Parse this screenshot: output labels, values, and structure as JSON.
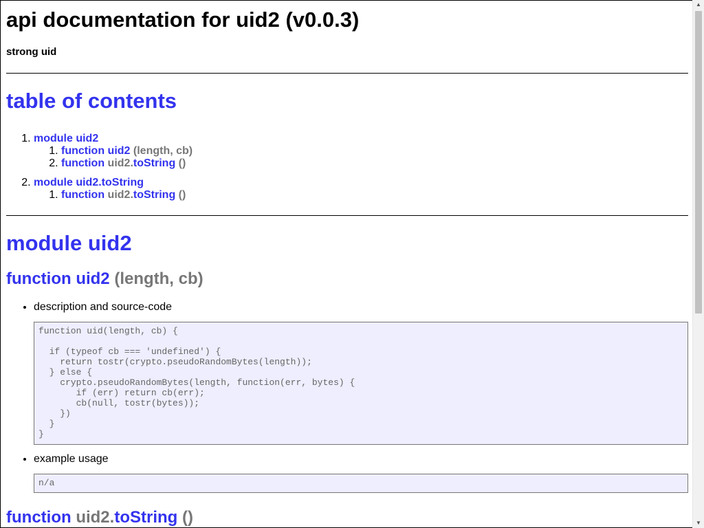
{
  "doc": {
    "title": "api documentation for uid2 (v0.0.3)",
    "subtitle": "strong uid"
  },
  "toc": {
    "heading": "table of contents",
    "modules": [
      {
        "label": "module uid2",
        "functions": [
          {
            "keyword": "function",
            "owner": "",
            "dot": "",
            "name": "uid2",
            "params": "(length, cb)"
          },
          {
            "keyword": "function",
            "owner": "uid2",
            "dot": ".",
            "name": "toString",
            "params": "()"
          }
        ]
      },
      {
        "label": "module uid2.toString",
        "functions": [
          {
            "keyword": "function",
            "owner": "uid2",
            "dot": ".",
            "name": "toString",
            "params": "()"
          }
        ]
      }
    ]
  },
  "module_section": {
    "heading": "module uid2",
    "fn1": {
      "keyword": "function",
      "name": "uid2",
      "params": "(length, cb)",
      "description_label": "description and source-code",
      "source_code": "function uid(length, cb) {\n\n  if (typeof cb === 'undefined') {\n    return tostr(crypto.pseudoRandomBytes(length));\n  } else {\n    crypto.pseudoRandomBytes(length, function(err, bytes) {\n       if (err) return cb(err);\n       cb(null, tostr(bytes));\n    })\n  }\n}",
      "example_label": "example usage",
      "example_code": "n/a"
    },
    "fn2": {
      "keyword": "function",
      "owner": "uid2",
      "dot": ".",
      "name": "toString",
      "params": "()"
    }
  },
  "colors": {
    "link": "#3333ee",
    "muted": "#777777",
    "code_bg": "#eeeeff"
  }
}
